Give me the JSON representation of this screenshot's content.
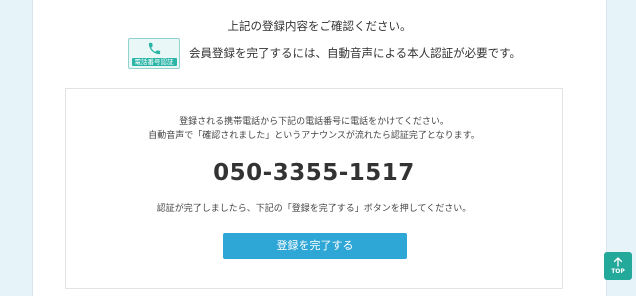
{
  "confirm": {
    "message": "上記の登録内容をご確認ください。"
  },
  "auth": {
    "badge_label": "電話番号認証",
    "badge_icon": "phone-icon",
    "notice": "会員登録を完了するには、自動音声による本人認証が必要です。"
  },
  "instructions": {
    "line1": "登録される携帯電話から下記の電話番号に電話をかけてください。",
    "line2": "自動音声で「確認されました」というアナウンスが流れたら認証完了となります。",
    "phone_number": "050-3355-1517",
    "line3": "認証が完了しましたら、下記の「登録を完了する」ボタンを押してください。",
    "complete_button_label": "登録を完了する"
  },
  "scroll_top": {
    "label": "TOP",
    "icon": "arrow-up-icon"
  },
  "colors": {
    "page_background": "#e6f4fa",
    "primary_button": "#2ea6d6",
    "top_button": "#23a99a",
    "badge_accent": "#2bb5a7"
  }
}
